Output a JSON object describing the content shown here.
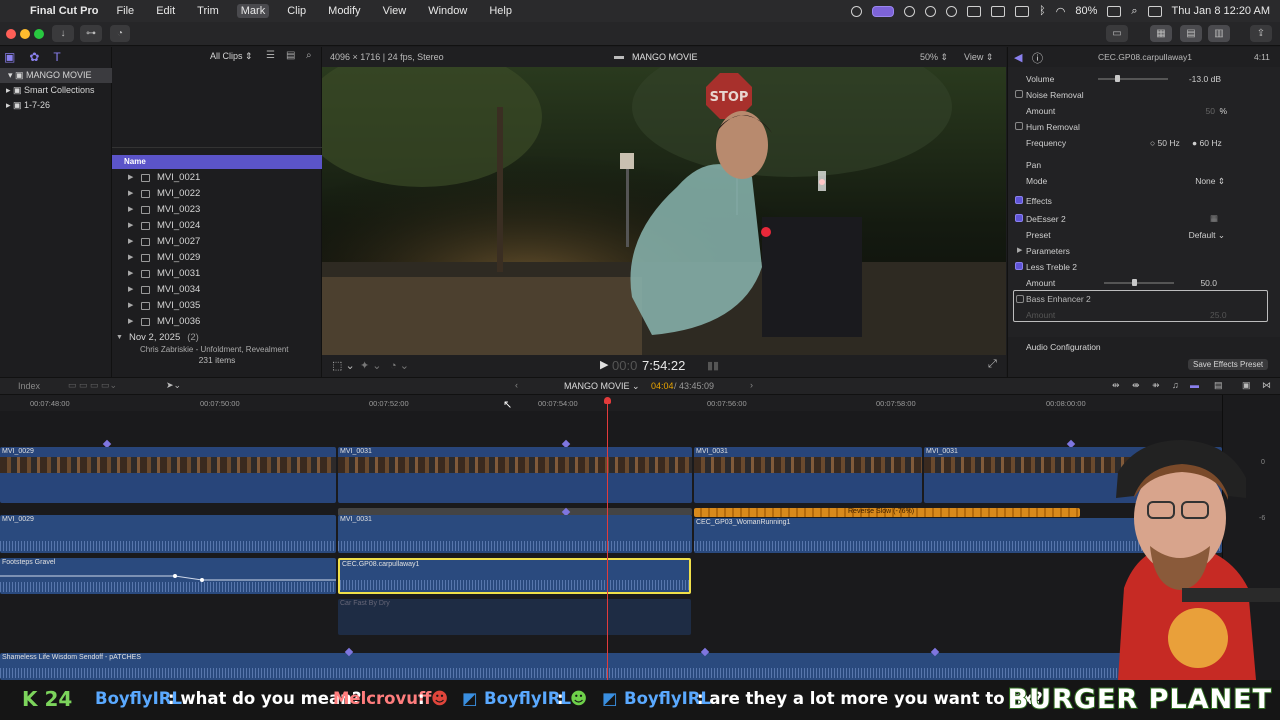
{
  "menubar": {
    "app_name": "Final Cut Pro",
    "items": [
      "File",
      "Edit",
      "Trim",
      "Mark",
      "Clip",
      "Modify",
      "View",
      "Window",
      "Help"
    ],
    "active_item": "Mark",
    "battery": "80%",
    "clock": "Thu Jan 8  12:20 AM"
  },
  "libraries": {
    "library": "MANGO MOVIE",
    "smart_collections": "Smart Collections",
    "event": "1-7-26"
  },
  "browser": {
    "filter": "All Clips",
    "column_header": "Name",
    "clips": [
      "MVI_0021",
      "MVI_0022",
      "MVI_0023",
      "MVI_0024",
      "MVI_0027",
      "MVI_0029",
      "MVI_0031",
      "MVI_0034",
      "MVI_0035",
      "MVI_0036"
    ],
    "date_group": "Nov 2, 2025",
    "date_group_count": "(2)",
    "next_item_partial": "Chris Zabriskie - Unfoldment, Revealment",
    "item_count": "231 items"
  },
  "viewer": {
    "format": "4096 × 1716 | 24 fps, Stereo",
    "title": "MANGO MOVIE",
    "zoom": "50%",
    "view_menu": "View",
    "timecode_dim": "00:0",
    "timecode": "7:54:22",
    "scene_sign": "STOP"
  },
  "inspector": {
    "clip_name": "CEC.GP08.carpullaway1",
    "duration": "4:11",
    "volume_label": "Volume",
    "volume_value": "-13.0",
    "volume_unit": "dB",
    "noise_removal": "Noise Removal",
    "amount_label": "Amount",
    "noise_amount": "50",
    "percent": "%",
    "hum_removal": "Hum Removal",
    "frequency_label": "Frequency",
    "freq_50": "50 Hz",
    "freq_60": "60 Hz",
    "pan_label": "Pan",
    "mode_label": "Mode",
    "mode_value": "None",
    "effects_label": "Effects",
    "deesser": "DeEsser 2",
    "preset_label": "Preset",
    "preset_value": "Default",
    "parameters_label": "Parameters",
    "less_treble": "Less Treble 2",
    "treble_amount": "50.0",
    "bass_enhancer": "Bass Enhancer 2",
    "bass_amount": "25.0",
    "audio_config": "Audio Configuration",
    "save_preset": "Save Effects Preset"
  },
  "timeline": {
    "index_label": "Index",
    "project": "MANGO MOVIE",
    "position": "04:04",
    "total": "43:45:09",
    "ruler": [
      "00:07:48:00",
      "00:07:50:00",
      "00:07:52:00",
      "00:07:54:00",
      "00:07:56:00",
      "00:07:58:00",
      "00:08:00:00"
    ],
    "clips": {
      "v_mvi0029": "MVI_0029",
      "v_mvi0031_a": "MVI_0031",
      "v_mvi0031_b": "MVI_0031",
      "v_mvi0031_c": "MVI_0031",
      "a_mvi0029": "MVI_0029",
      "a_mvi0031": "MVI_0031",
      "retime": "Reverse Slow (-76%)",
      "woman_running": "CEC_GP03_WomanRunning1",
      "footsteps": "Footsteps Gravel",
      "carpull": "CEC.GP08.carpullaway1",
      "car_fast": "Car Fast By Dry",
      "music": "Shameless Life Wisdom Sendoff - pATCHES"
    },
    "meter_labels": [
      "0",
      "-6"
    ]
  },
  "chatbar": {
    "k_count": "K 24",
    "msg1_user": "BoyflyIRL",
    "msg1_text": ": what do you mean?",
    "msg2_user": "Melcrovuff",
    "msg2_text": ":",
    "msg3_user": "BoyflyIRL",
    "msg3_text": ":",
    "msg4_user": "BoyflyIRL",
    "msg4_text": ": are they a lot more you want to fix?",
    "brand": "BURGER PLANET"
  },
  "colors": {
    "accent": "#5b54c9",
    "playhead": "#e23b3b",
    "clip_blue": "#2a4a7e",
    "retime_orange": "#d88a1c",
    "selected_clip_border": "#f0e04a"
  }
}
